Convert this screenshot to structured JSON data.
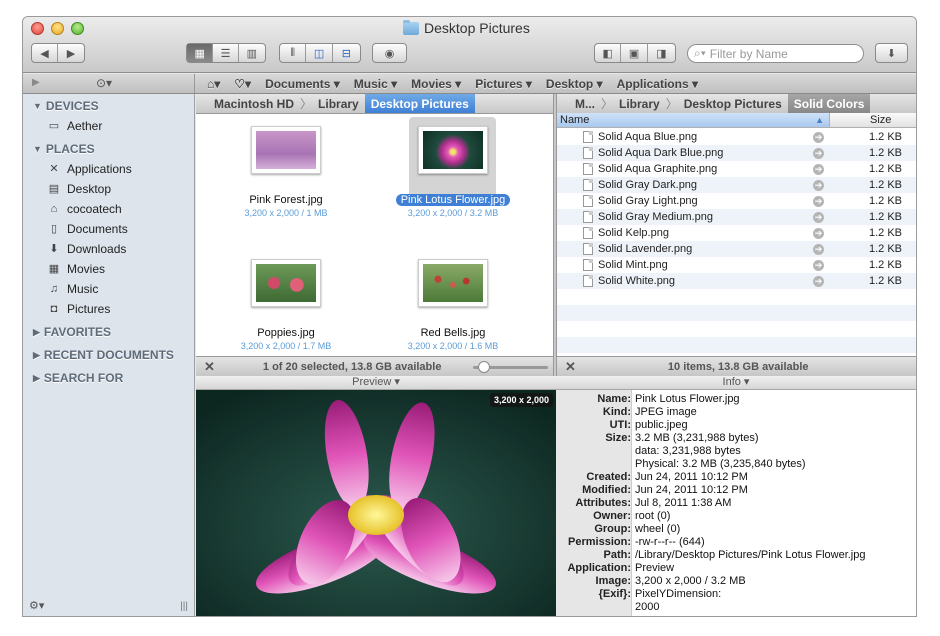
{
  "window": {
    "title": "Desktop Pictures"
  },
  "toolbar": {
    "nav_back": "◀",
    "nav_fwd": "▶",
    "search_placeholder": "Filter by Name"
  },
  "bookmarks": [
    "Documents ▾",
    "Music ▾",
    "Movies ▾",
    "Pictures ▾",
    "Desktop ▾",
    "Applications ▾"
  ],
  "sidebar": {
    "devices_label": "DEVICES",
    "devices": [
      {
        "label": "Aether",
        "icon": "drive-icon"
      }
    ],
    "places_label": "PLACES",
    "places": [
      {
        "label": "Applications",
        "icon": "applications-icon"
      },
      {
        "label": "Desktop",
        "icon": "desktop-icon"
      },
      {
        "label": "cocoatech",
        "icon": "home-icon"
      },
      {
        "label": "Documents",
        "icon": "documents-icon"
      },
      {
        "label": "Downloads",
        "icon": "downloads-icon"
      },
      {
        "label": "Movies",
        "icon": "movies-icon"
      },
      {
        "label": "Music",
        "icon": "music-icon"
      },
      {
        "label": "Pictures",
        "icon": "pictures-icon"
      }
    ],
    "favorites": "FAVORITES",
    "recent": "RECENT DOCUMENTS",
    "search_for": "SEARCH FOR"
  },
  "left_pane": {
    "path": [
      "Macintosh HD",
      "Library",
      "Desktop Pictures"
    ],
    "items": [
      {
        "name": "Pink Forest.jpg",
        "meta": "3,200 x 2,000 / 1 MB"
      },
      {
        "name": "Pink Lotus Flower.jpg",
        "meta": "3,200 x 2,000 / 3.2 MB"
      },
      {
        "name": "Poppies.jpg",
        "meta": "3,200 x 2,000 / 1.7 MB"
      },
      {
        "name": "Red Bells.jpg",
        "meta": "3,200 x 2,000 / 1.6 MB"
      }
    ],
    "status": "1 of 20 selected, 13.8 GB available"
  },
  "right_pane": {
    "path": [
      "M...",
      "Library",
      "Desktop Pictures",
      "Solid Colors"
    ],
    "col_name": "Name",
    "col_size": "Size",
    "files": [
      {
        "name": "Solid Aqua Blue.png",
        "size": "1.2 KB"
      },
      {
        "name": "Solid Aqua Dark Blue.png",
        "size": "1.2 KB"
      },
      {
        "name": "Solid Aqua Graphite.png",
        "size": "1.2 KB"
      },
      {
        "name": "Solid Gray Dark.png",
        "size": "1.2 KB"
      },
      {
        "name": "Solid Gray Light.png",
        "size": "1.2 KB"
      },
      {
        "name": "Solid Gray Medium.png",
        "size": "1.2 KB"
      },
      {
        "name": "Solid Kelp.png",
        "size": "1.2 KB"
      },
      {
        "name": "Solid Lavender.png",
        "size": "1.2 KB"
      },
      {
        "name": "Solid Mint.png",
        "size": "1.2 KB"
      },
      {
        "name": "Solid White.png",
        "size": "1.2 KB"
      }
    ],
    "status": "10 items, 13.8 GB available"
  },
  "preview": {
    "header": "Preview ▾",
    "dims": "3,200 x 2,000"
  },
  "info": {
    "header": "Info ▾",
    "rows": [
      {
        "label": "Name:",
        "value": "Pink Lotus Flower.jpg"
      },
      {
        "label": "Kind:",
        "value": "JPEG image"
      },
      {
        "label": "UTI:",
        "value": "public.jpeg"
      },
      {
        "label": "Size:",
        "value": "3.2 MB (3,231,988 bytes)"
      },
      {
        "label": "",
        "value": "data: 3,231,988 bytes"
      },
      {
        "label": "",
        "value": "Physical: 3.2 MB (3,235,840 bytes)"
      },
      {
        "label": "Created:",
        "value": "Jun 24, 2011 10:12 PM"
      },
      {
        "label": "Modified:",
        "value": "Jun 24, 2011 10:12 PM"
      },
      {
        "label": "Attributes:",
        "value": "Jul 8, 2011 1:38 AM"
      },
      {
        "label": "Owner:",
        "value": "root (0)"
      },
      {
        "label": "Group:",
        "value": "wheel (0)"
      },
      {
        "label": "Permission:",
        "value": "-rw-r--r-- (644)"
      },
      {
        "label": "Path:",
        "value": "/Library/Desktop Pictures/Pink Lotus Flower.jpg"
      },
      {
        "label": "Application:",
        "value": "Preview"
      },
      {
        "label": "Image:",
        "value": "3,200 x 2,000 / 3.2 MB"
      },
      {
        "label": "{Exif}:",
        "value": "PixelYDimension:"
      },
      {
        "label": "",
        "value": "    2000"
      }
    ]
  },
  "colors": {
    "selection": "#3f80d6",
    "sidebar": "#dde4ec",
    "accent_blue": "#5a9cd8"
  }
}
